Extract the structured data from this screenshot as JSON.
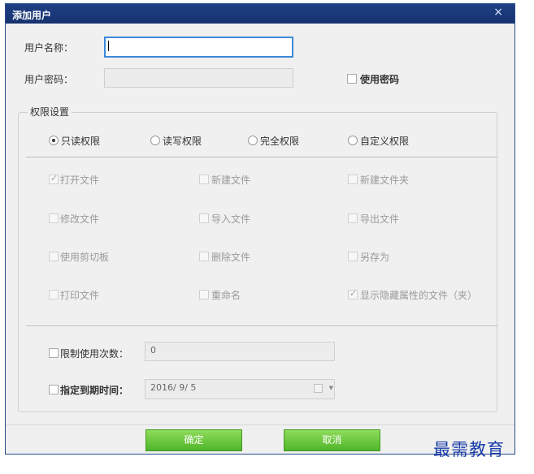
{
  "window": {
    "title": "添加用户",
    "close_glyph": "×"
  },
  "form": {
    "username_label": "用户名称：",
    "username_value": "",
    "password_label": "用户密码：",
    "password_value": "",
    "use_password_label": "使用密码"
  },
  "permissions": {
    "group_title": "权限设置",
    "modes": [
      "只读权限",
      "读写权限",
      "完全权限",
      "自定义权限"
    ],
    "selected_mode": "只读权限",
    "items": [
      {
        "label": "打开文件",
        "checked": true
      },
      {
        "label": "新建文件",
        "checked": false
      },
      {
        "label": "新建文件夹",
        "checked": false
      },
      {
        "label": "修改文件",
        "checked": false
      },
      {
        "label": "导入文件",
        "checked": false
      },
      {
        "label": "导出文件",
        "checked": false
      },
      {
        "label": "使用剪切板",
        "checked": false
      },
      {
        "label": "删除文件",
        "checked": false
      },
      {
        "label": "另存为",
        "checked": false
      },
      {
        "label": "打印文件",
        "checked": false
      },
      {
        "label": "重命名",
        "checked": false
      },
      {
        "label": "显示隐藏属性的文件（夹）",
        "checked": true
      }
    ]
  },
  "limits": {
    "use_count_label": "限制使用次数：",
    "use_count_value": "0",
    "expire_label": "指定到期时间：",
    "expire_value": "2016/ 9/ 5"
  },
  "buttons": {
    "ok": "确定",
    "cancel": "取消"
  },
  "watermark": "最需教育",
  "colors": {
    "title_bar": "#1f3f84",
    "button": "#5cc233",
    "focus_border": "#3c8bd8",
    "watermark": "#1a3ea8"
  },
  "icons": {
    "close": "close-icon",
    "checkbox": "checkbox-icon",
    "radio": "radio-icon",
    "calendar": "calendar-icon"
  }
}
